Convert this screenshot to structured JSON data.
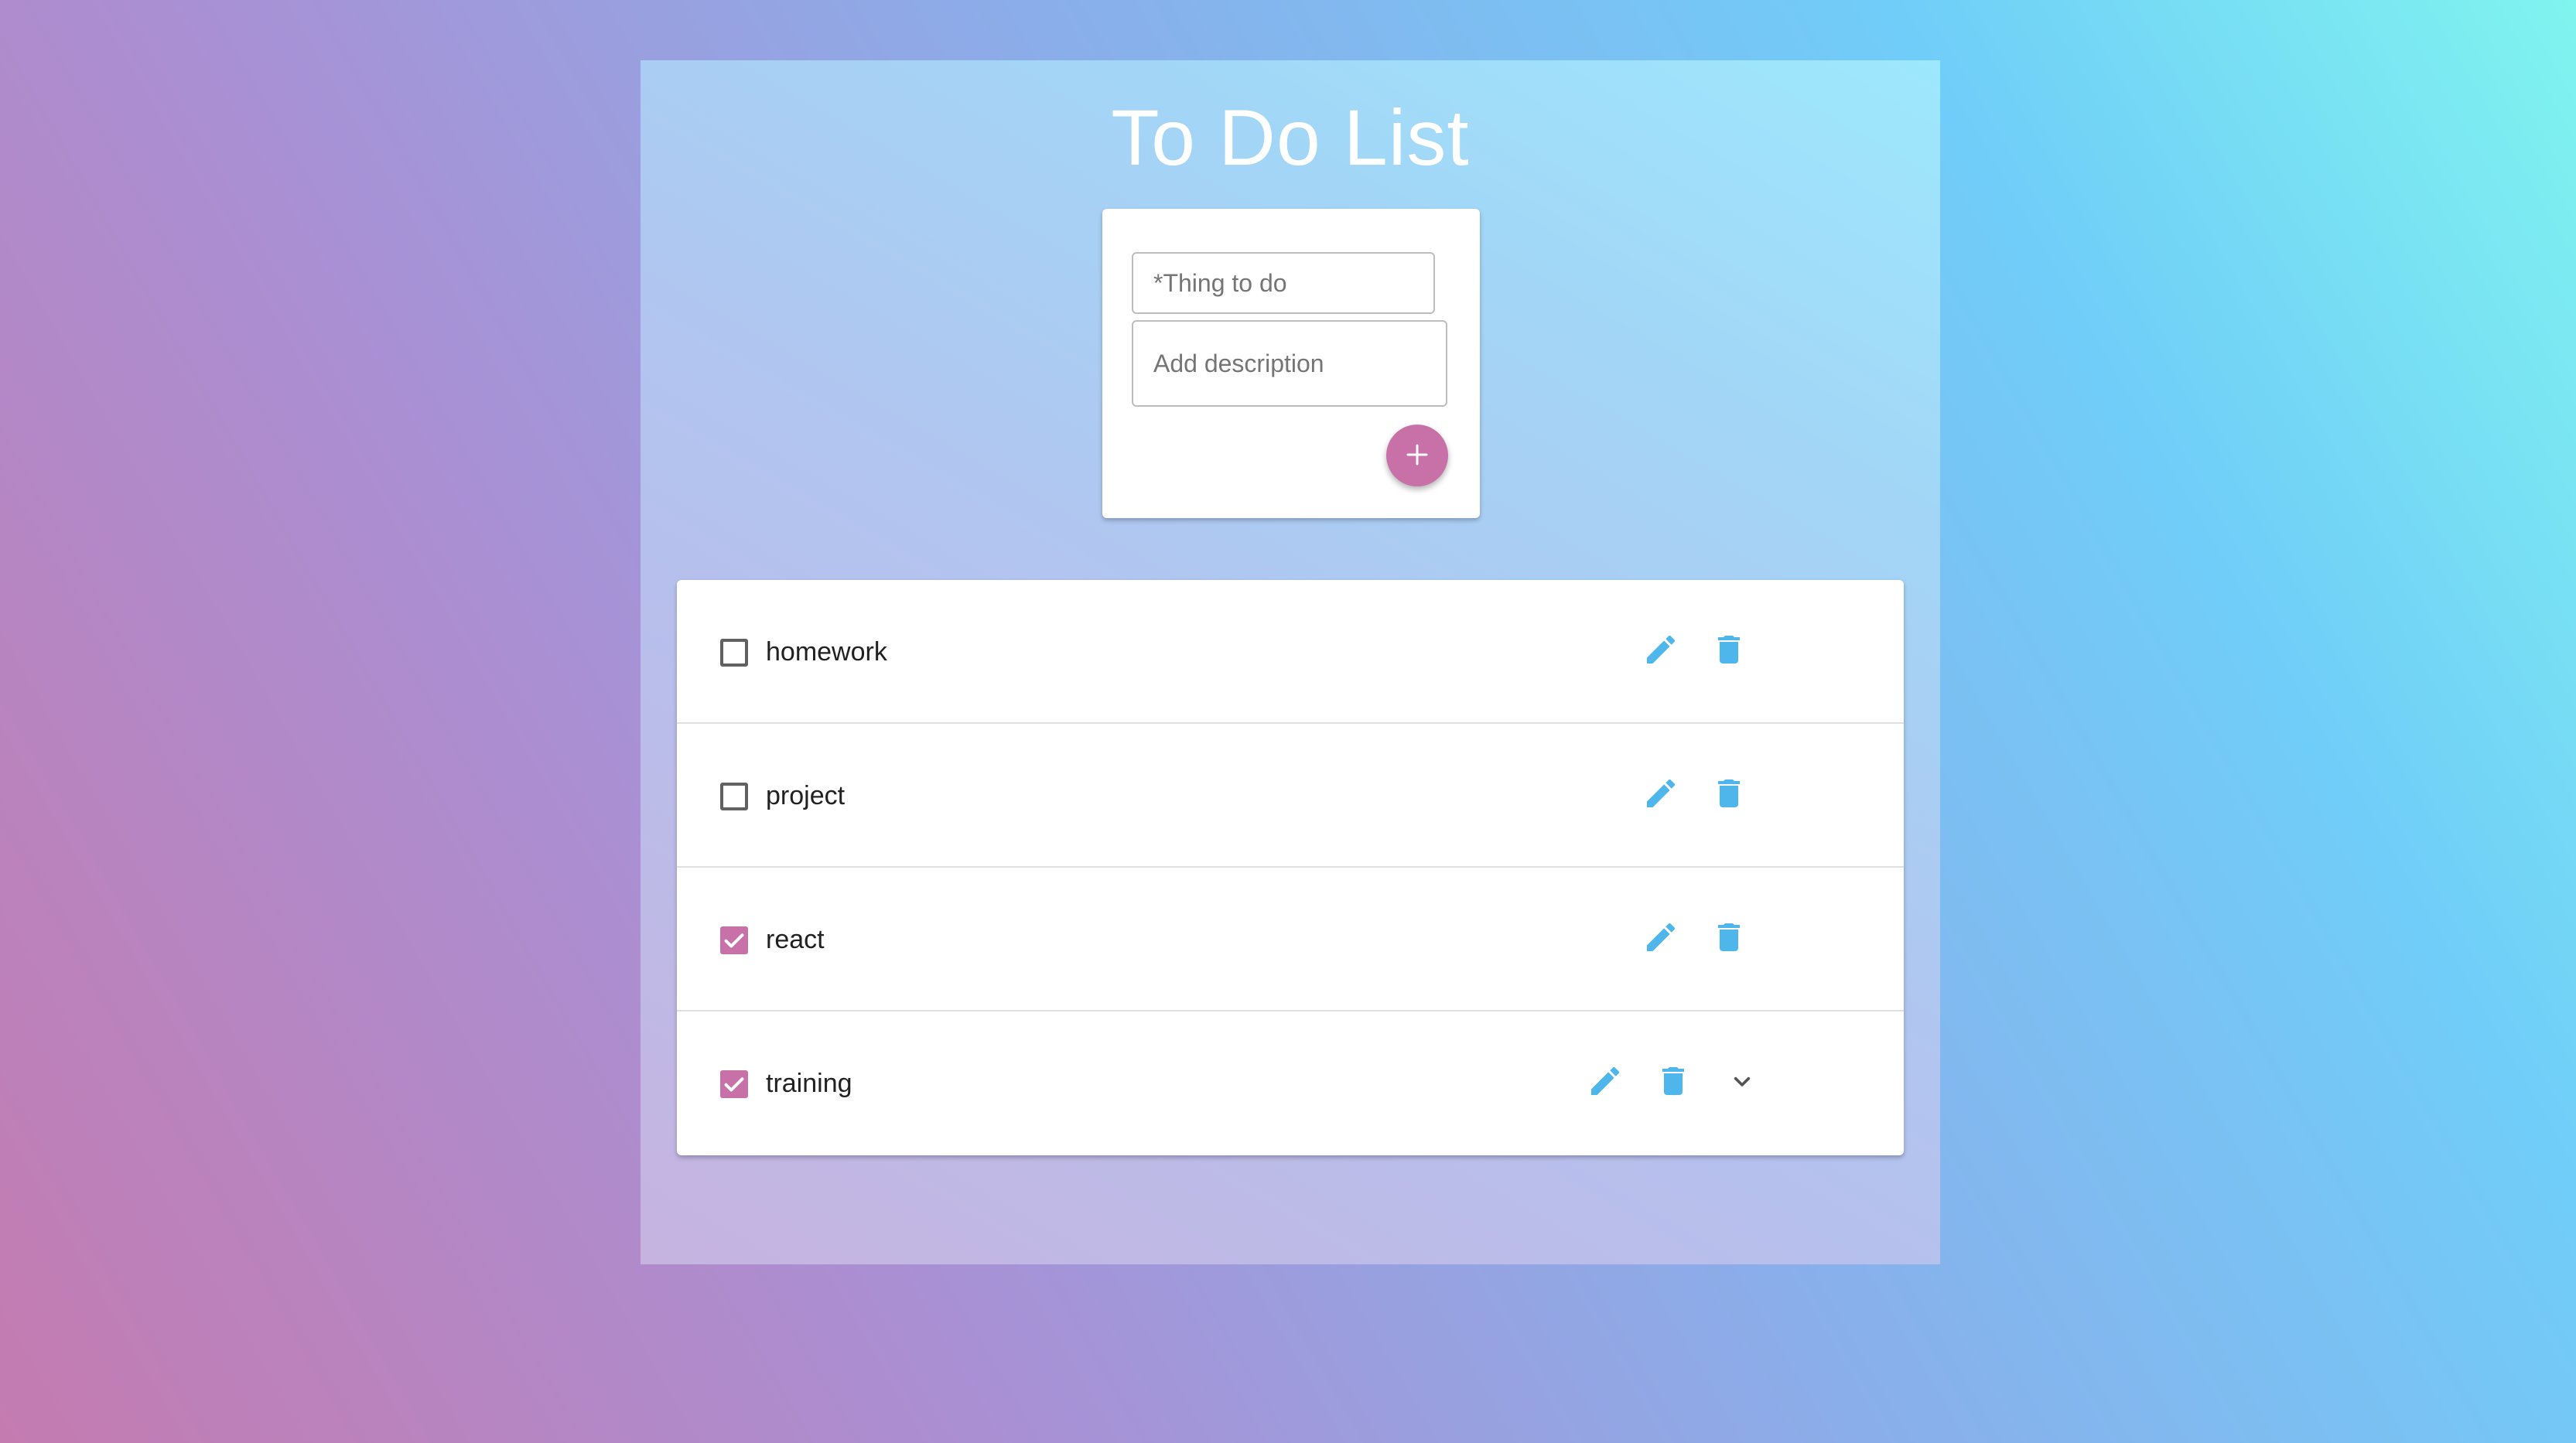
{
  "app": {
    "title": "To Do List"
  },
  "add_form": {
    "thing_placeholder": "*Thing to do",
    "description_placeholder": "Add description",
    "add_icon": "plus-icon",
    "accent_color": "#c771a8"
  },
  "todos": [
    {
      "label": "homework",
      "checked": false,
      "expandable": false
    },
    {
      "label": "project",
      "checked": false,
      "expandable": false
    },
    {
      "label": "react",
      "checked": true,
      "expandable": false
    },
    {
      "label": "training",
      "checked": true,
      "expandable": true
    }
  ],
  "icons": {
    "edit": "pencil-icon",
    "delete": "trash-icon",
    "expand": "chevron-down-icon",
    "icon_color": "#4fb6ec"
  }
}
